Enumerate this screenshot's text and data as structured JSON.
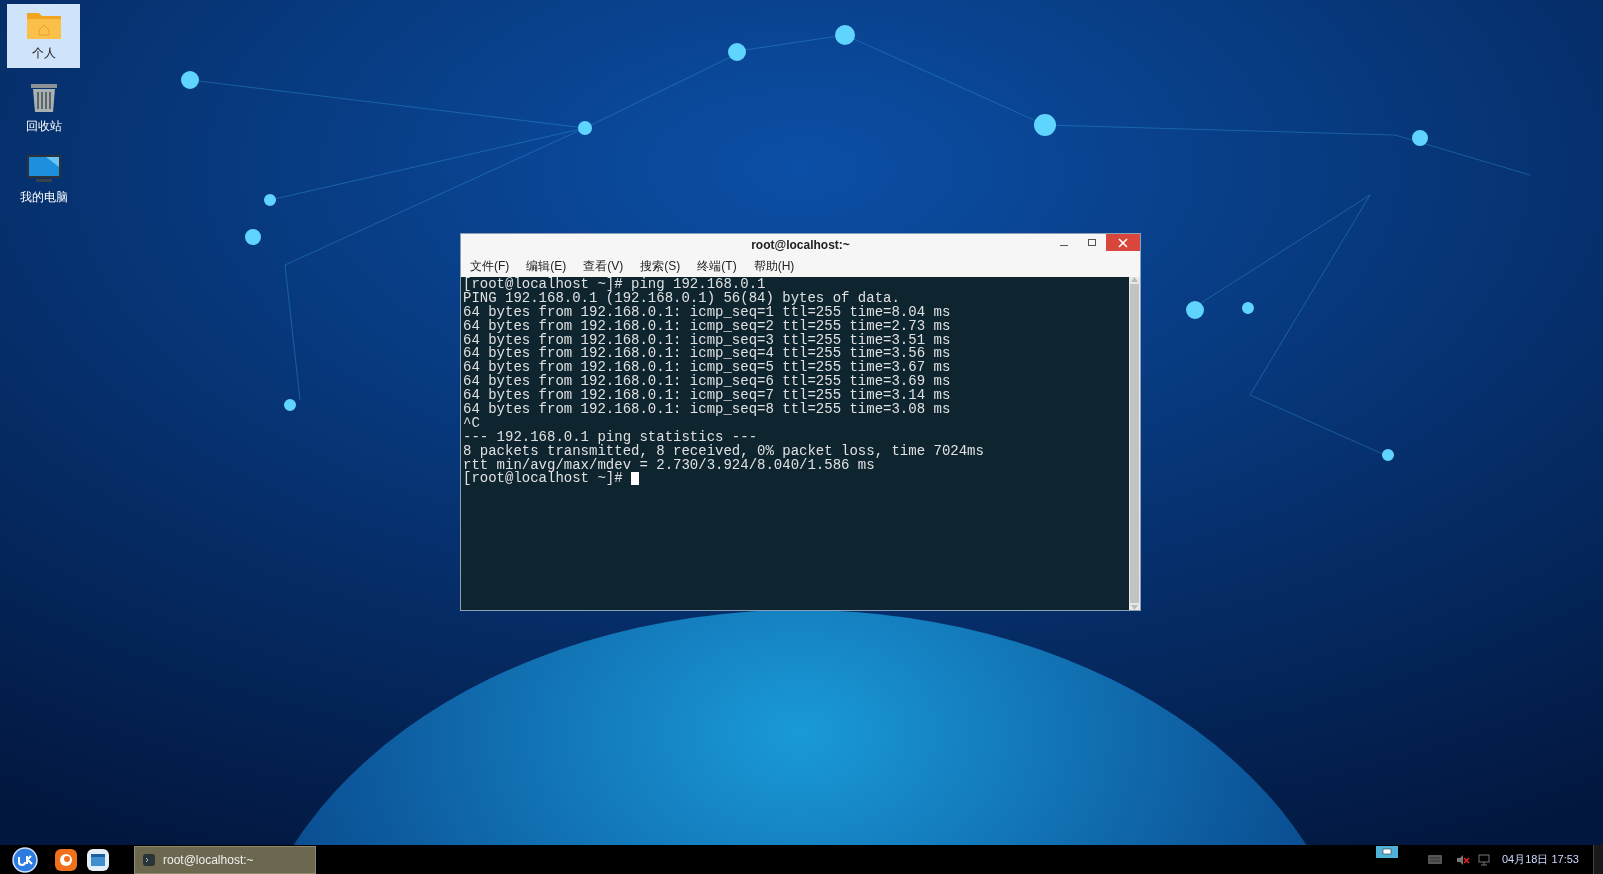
{
  "desktop_icons": [
    {
      "label": "个人",
      "kind": "folder",
      "selected": true
    },
    {
      "label": "回收站",
      "kind": "trash",
      "selected": false
    },
    {
      "label": "我的电脑",
      "kind": "computer",
      "selected": false
    }
  ],
  "window": {
    "title": "root@localhost:~",
    "menu": [
      "文件(F)",
      "编辑(E)",
      "查看(V)",
      "搜索(S)",
      "终端(T)",
      "帮助(H)"
    ],
    "terminal_lines": [
      "[root@localhost ~]# ping 192.168.0.1",
      "PING 192.168.0.1 (192.168.0.1) 56(84) bytes of data.",
      "64 bytes from 192.168.0.1: icmp_seq=1 ttl=255 time=8.04 ms",
      "64 bytes from 192.168.0.1: icmp_seq=2 ttl=255 time=2.73 ms",
      "64 bytes from 192.168.0.1: icmp_seq=3 ttl=255 time=3.51 ms",
      "64 bytes from 192.168.0.1: icmp_seq=4 ttl=255 time=3.56 ms",
      "64 bytes from 192.168.0.1: icmp_seq=5 ttl=255 time=3.67 ms",
      "64 bytes from 192.168.0.1: icmp_seq=6 ttl=255 time=3.69 ms",
      "64 bytes from 192.168.0.1: icmp_seq=7 ttl=255 time=3.14 ms",
      "64 bytes from 192.168.0.1: icmp_seq=8 ttl=255 time=3.08 ms",
      "^C",
      "--- 192.168.0.1 ping statistics ---",
      "8 packets transmitted, 8 received, 0% packet loss, time 7024ms",
      "rtt min/avg/max/mdev = 2.730/3.924/8.040/1.586 ms",
      "[root@localhost ~]# "
    ]
  },
  "taskbar": {
    "tasks": [
      {
        "label": "root@localhost:~",
        "selected": true
      }
    ],
    "clock": "04月18日 17:53"
  }
}
